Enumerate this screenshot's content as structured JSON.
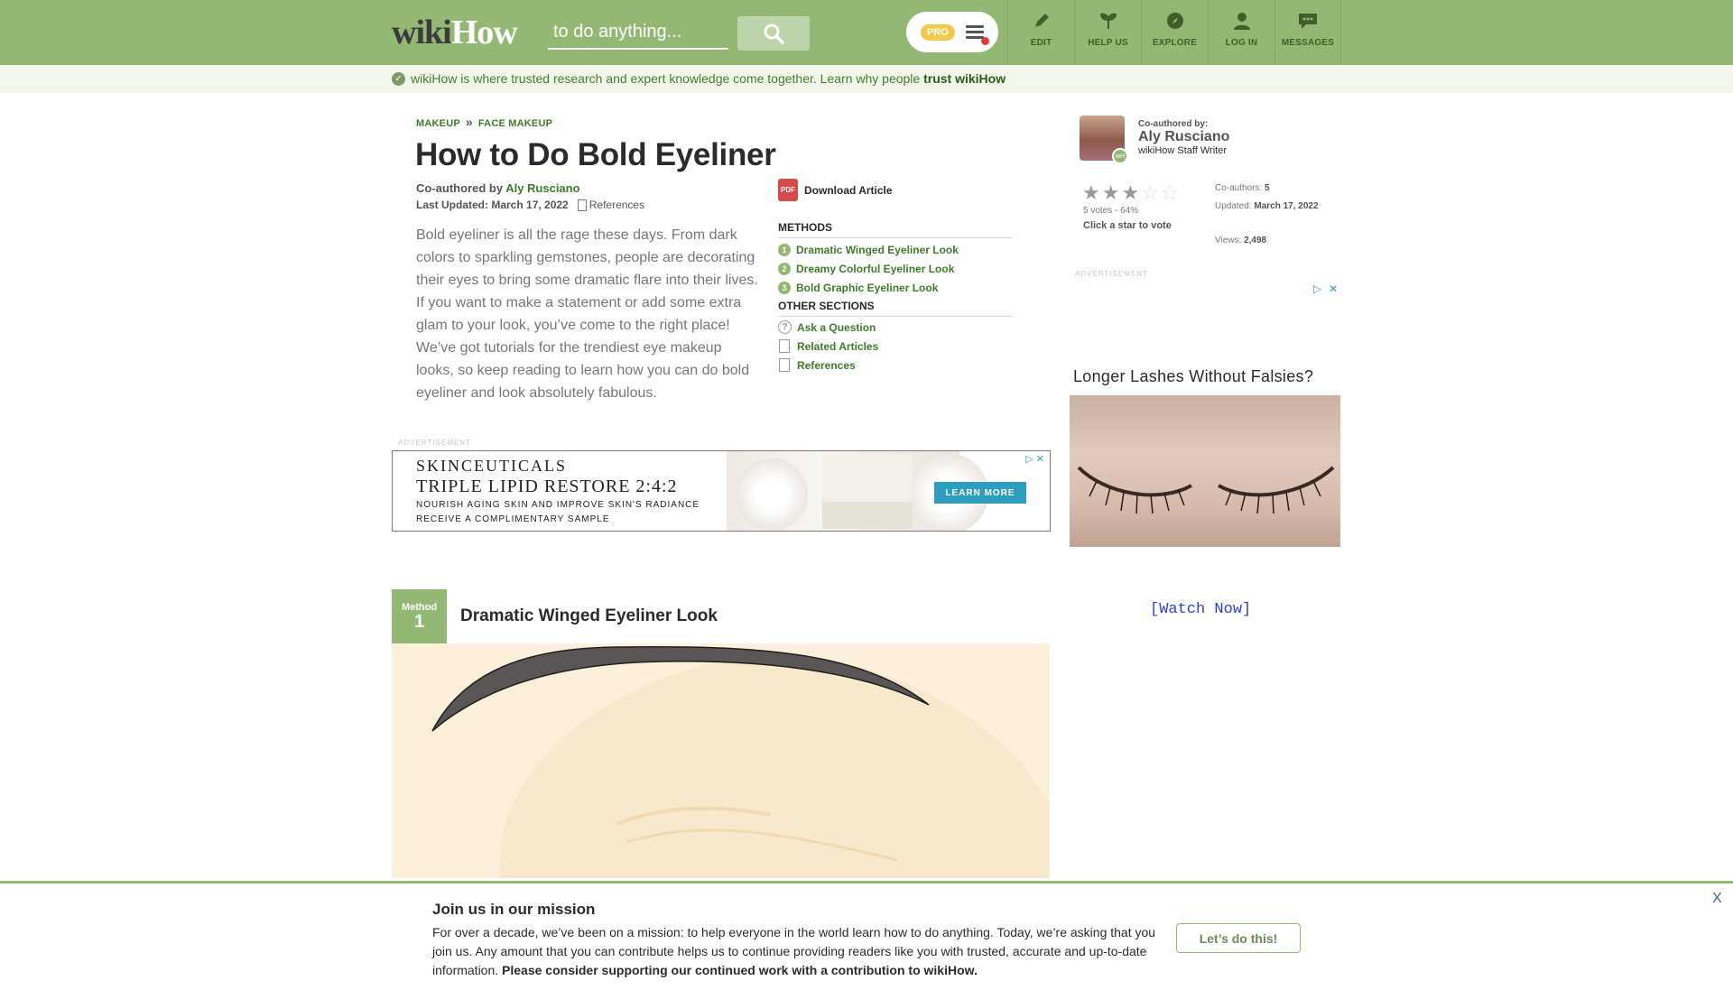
{
  "header": {
    "logo_part1": "wiki",
    "logo_part2": "How",
    "search_placeholder": "to do anything...",
    "pro_label": "PRO",
    "nav": [
      {
        "label": "EDIT",
        "icon": "pencil-icon"
      },
      {
        "label": "HELP US",
        "icon": "sprout-icon"
      },
      {
        "label": "EXPLORE",
        "icon": "compass-icon"
      },
      {
        "label": "LOG IN",
        "icon": "user-icon"
      },
      {
        "label": "MESSAGES",
        "icon": "chat-icon"
      }
    ]
  },
  "trust": {
    "text": "wikiHow is where trusted research and expert knowledge come together. Learn why people ",
    "link": "trust wikiHow"
  },
  "breadcrumb": [
    "MAKEUP",
    "FACE MAKEUP"
  ],
  "article": {
    "title": "How to Do Bold Eyeliner",
    "coauthored_prefix": "Co-authored by ",
    "author": "Aly Rusciano",
    "last_updated": "Last Updated: March 17, 2022",
    "references_label": "References",
    "intro": "Bold eyeliner is all the rage these days. From dark colors to sparkling gemstones, people are decorating their eyes to bring some dramatic flare into their lives. If you want to make a statement or add some extra glam to your look, you’ve come to the right place! We’ve got tutorials for the trendiest eye makeup looks, so keep reading to learn how you can do bold eyeliner and look absolutely fabulous."
  },
  "toc": {
    "download": "Download Article",
    "pdf_label": "PDF",
    "methods_heading": "METHODS",
    "methods": [
      {
        "num": "1",
        "label": "Dramatic Winged Eyeliner Look"
      },
      {
        "num": "2",
        "label": "Dreamy Colorful Eyeliner Look"
      },
      {
        "num": "3",
        "label": "Bold Graphic Eyeliner Look"
      }
    ],
    "other_heading": "OTHER SECTIONS",
    "other": [
      "Ask a Question",
      "Related Articles",
      "References"
    ]
  },
  "ad_label": "ADVERTISEMENT",
  "banner_ad": {
    "brand": "SKINCEUTICALS",
    "headline": "TRIPLE LIPID RESTORE 2:4:2",
    "sub1": "NOURISH AGING SKIN AND IMPROVE SKIN'S RADIANCE",
    "sub2": "RECEIVE A COMPLIMENTARY SAMPLE",
    "cta": "LEARN MORE"
  },
  "method": {
    "label": "Method",
    "num": "1",
    "title": "Dramatic Winged Eyeliner Look"
  },
  "sidebar": {
    "coauthored_by": "Co-authored by:",
    "author": "Aly Rusciano",
    "role": "wikiHow Staff Writer",
    "rating": {
      "filled": 3,
      "total": 5
    },
    "votes": "5 votes - 64%",
    "click_star": "Click a star to vote",
    "coauthors_label": "Co-authors: ",
    "coauthors": "5",
    "updated_label": "Updated: ",
    "updated": "March 17, 2022",
    "views_label": "Views: ",
    "views": "2,498",
    "ad_title": "Longer Lashes Without Falsies?",
    "watch": "[Watch Now]"
  },
  "mission": {
    "title": "Join us in our mission",
    "text": "For over a decade, we’ve been on a mission: to help everyone in the world learn how to do anything. Today, we’re asking that you join us. Any amount that you can contribute helps us to continue providing readers like you with trusted, accurate and up-to-date information. ",
    "bold": "Please consider supporting our continued work with a contribution to wikiHow.",
    "button": "Let’s do this!",
    "close": "X"
  },
  "colors": {
    "brand_green": "#93b874",
    "link_green": "#3e7a2b"
  }
}
